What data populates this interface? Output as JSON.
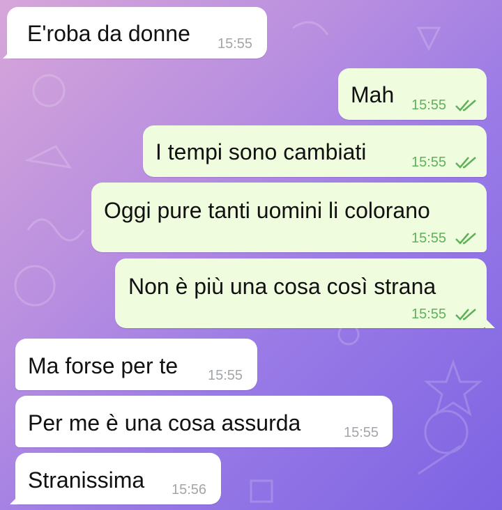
{
  "colors": {
    "incoming_bubble": "#ffffff",
    "outgoing_bubble": "#effdde",
    "outgoing_time": "#5fb159",
    "incoming_time": "#a2a6aa"
  },
  "messages": [
    {
      "direction": "in",
      "text": "E'roba da donne",
      "time": "15:55"
    },
    {
      "direction": "out",
      "text": "Mah",
      "time": "15:55",
      "status": "read-double-check-icon"
    },
    {
      "direction": "out",
      "text": "I tempi sono cambiati",
      "time": "15:55",
      "status": "read-double-check-icon"
    },
    {
      "direction": "out",
      "text": "Oggi pure tanti uomini li colorano",
      "time": "15:55",
      "status": "read-double-check-icon"
    },
    {
      "direction": "out",
      "text": "Non è più una cosa così strana",
      "time": "15:55",
      "status": "read-double-check-icon"
    },
    {
      "direction": "in",
      "text": "Ma forse per te",
      "time": "15:55"
    },
    {
      "direction": "in",
      "text": "Per me è una cosa assurda",
      "time": "15:55"
    },
    {
      "direction": "in",
      "text": "Stranissima",
      "time": "15:56"
    }
  ]
}
